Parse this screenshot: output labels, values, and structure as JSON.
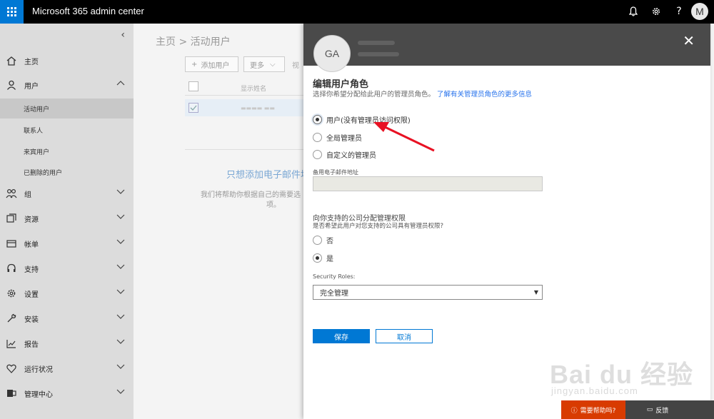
{
  "app": {
    "title": "Microsoft 365 admin center",
    "user_initial": "M"
  },
  "topbar": {
    "bell": "bell-icon",
    "gear": "gear-icon",
    "help": "?"
  },
  "nav": {
    "items": [
      {
        "label": "主页",
        "icon": "home-icon"
      },
      {
        "label": "用户",
        "icon": "user-icon"
      },
      {
        "label": "组",
        "icon": "group-icon"
      },
      {
        "label": "资源",
        "icon": "resources-icon"
      },
      {
        "label": "帐单",
        "icon": "billing-icon"
      },
      {
        "label": "支持",
        "icon": "headset-icon"
      },
      {
        "label": "设置",
        "icon": "gear-icon"
      },
      {
        "label": "安装",
        "icon": "wrench-icon"
      },
      {
        "label": "报告",
        "icon": "chart-icon"
      },
      {
        "label": "运行状况",
        "icon": "heart-icon"
      },
      {
        "label": "管理中心",
        "icon": "exchange-icon"
      }
    ],
    "subitems": [
      "活动用户",
      "联系人",
      "来宾用户",
      "已删除的用户"
    ]
  },
  "main": {
    "breadcrumb": "主页 > 活动用户",
    "add_user": "添加用户",
    "more": "更多",
    "view_partial": "视",
    "col_display_name": "显示姓名",
    "empty_title": "只想添加电子邮件地",
    "empty_text_1": "我们将帮助你根据自己的需要选",
    "empty_text_2": "项。"
  },
  "panel": {
    "initials": "GA",
    "title": "编辑用户角色",
    "desc": "选择你希望分配给此用户的管理员角色。",
    "desc_link": "了解有关管理员角色的更多信息",
    "roles": [
      {
        "label": "用户(没有管理员访问权限)",
        "checked": true
      },
      {
        "label": "全局管理员",
        "checked": false
      },
      {
        "label": "自定义的管理员",
        "checked": false
      }
    ],
    "alt_email_label": "备用电子邮件地址",
    "alt_email_value": "",
    "partner_title": "向你支持的公司分配管理权限",
    "partner_note": "是否希望此用户对您支持的公司具有管理员权限?",
    "partner_options": [
      {
        "label": "否",
        "checked": false
      },
      {
        "label": "是",
        "checked": true
      }
    ],
    "security_roles_label": "Security Roles:",
    "security_roles_value": "完全管理",
    "save": "保存",
    "cancel": "取消"
  },
  "footer": {
    "help": "需要帮助吗?",
    "feedback": "反馈"
  },
  "watermark": {
    "logo": "Bai du 经验",
    "url": "jingyan.baidu.com"
  },
  "colors": {
    "accent": "#0078d4",
    "help": "#d83b01",
    "arrow": "#e81123"
  }
}
